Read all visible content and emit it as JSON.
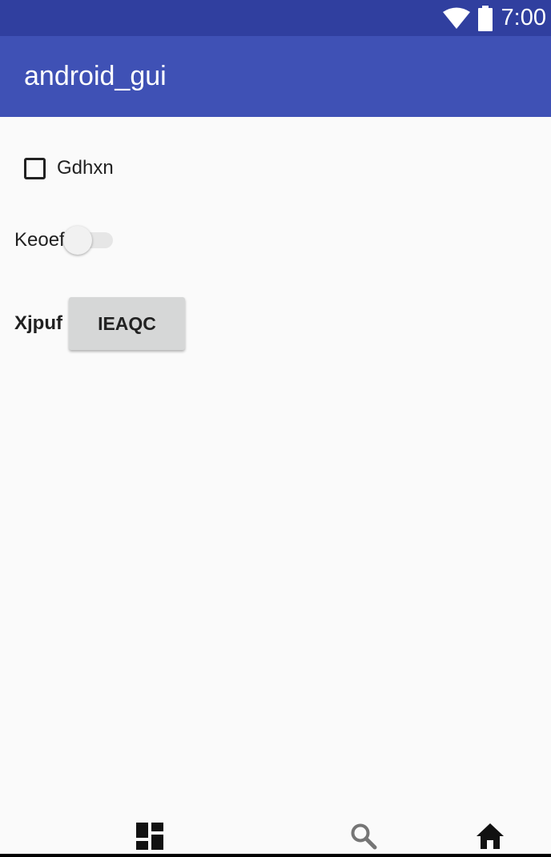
{
  "status_bar": {
    "time": "7:00",
    "icons": [
      "wifi-icon",
      "battery-icon"
    ],
    "background_color": "#303f9f"
  },
  "app_bar": {
    "title": "android_gui",
    "background_color": "#3f51b5"
  },
  "content": {
    "checkbox": {
      "label": "Gdhxn",
      "checked": false
    },
    "switch": {
      "label": "Keoef",
      "on": false
    },
    "button_row": {
      "label": "Xjpuf",
      "button_label": "IEAQC"
    }
  },
  "bottom_nav": {
    "items": [
      {
        "icon": "dashboard-icon"
      },
      {
        "icon": "search-icon"
      },
      {
        "icon": "home-icon"
      }
    ]
  }
}
